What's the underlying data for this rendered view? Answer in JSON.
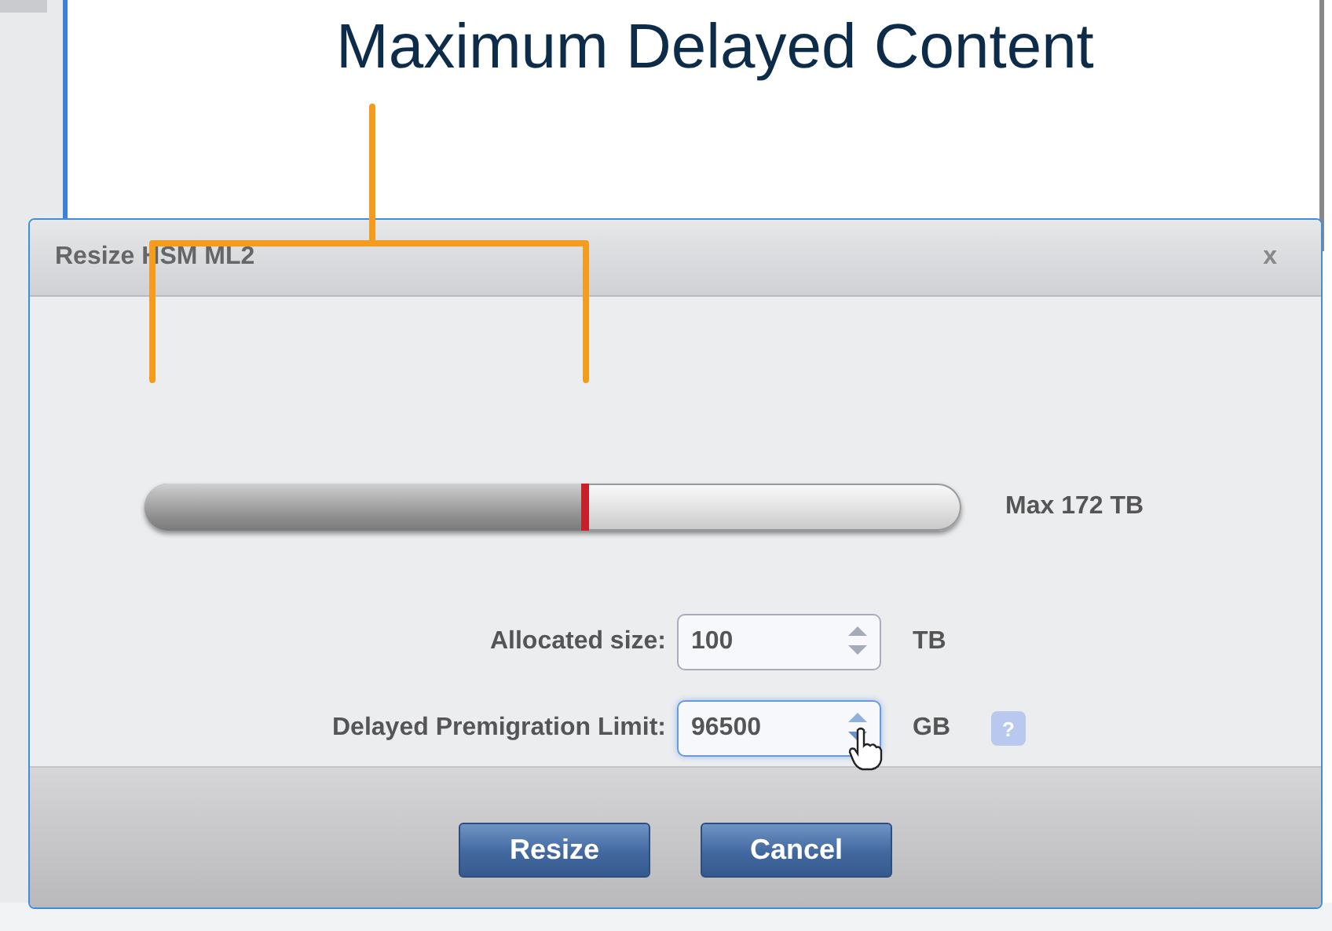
{
  "annotation": {
    "title": "Maximum Delayed Content"
  },
  "dialog": {
    "title": "Resize HSM ML2",
    "close": "x",
    "slider": {
      "level": 0.544,
      "max_label": "Max 172 TB"
    },
    "fields": [
      {
        "label": "Allocated size:",
        "value": "100",
        "unit": "TB",
        "focused": false
      },
      {
        "label": "Delayed Premigration Limit:",
        "value": "96500",
        "unit": "GB",
        "focused": true,
        "help": "?"
      }
    ],
    "buttons": [
      "Resize",
      "Cancel"
    ]
  }
}
